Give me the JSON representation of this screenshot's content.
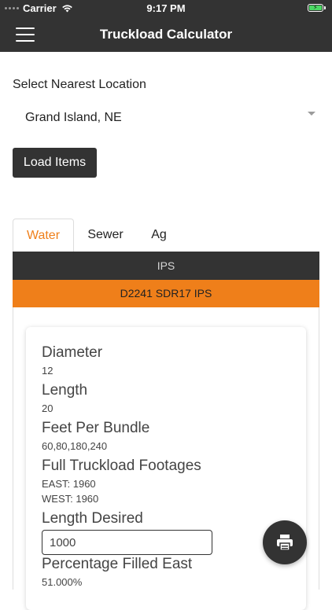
{
  "status_bar": {
    "carrier": "Carrier",
    "time": "9:17 PM"
  },
  "nav": {
    "title": "Truckload Calculator",
    "menu_icon": "hamburger-menu-icon"
  },
  "location": {
    "label": "Select Nearest Location",
    "selected": "Grand Island, NE"
  },
  "load_button": "Load Items",
  "tabs": [
    {
      "label": "Water",
      "active": true
    },
    {
      "label": "Sewer",
      "active": false
    },
    {
      "label": "Ag",
      "active": false
    }
  ],
  "category_bar": "IPS",
  "product_bar": "D2241 SDR17 IPS",
  "details": {
    "diameter_label": "Diameter",
    "diameter_value": "12",
    "length_label": "Length",
    "length_value": "20",
    "feet_per_bundle_label": "Feet Per Bundle",
    "feet_per_bundle_value": "60,80,180,240",
    "full_truckload_label": "Full Truckload Footages",
    "full_truckload_east": "EAST: 1960",
    "full_truckload_west": "WEST: 1960",
    "length_desired_label": "Length Desired",
    "length_desired_value": "1000",
    "percentage_east_label": "Percentage Filled East",
    "percentage_east_value": "51.000%"
  },
  "colors": {
    "bar_dark": "#333333",
    "accent_orange": "#ef7f1a",
    "battery_green": "#4cd964"
  },
  "fab_icon": "print-icon"
}
